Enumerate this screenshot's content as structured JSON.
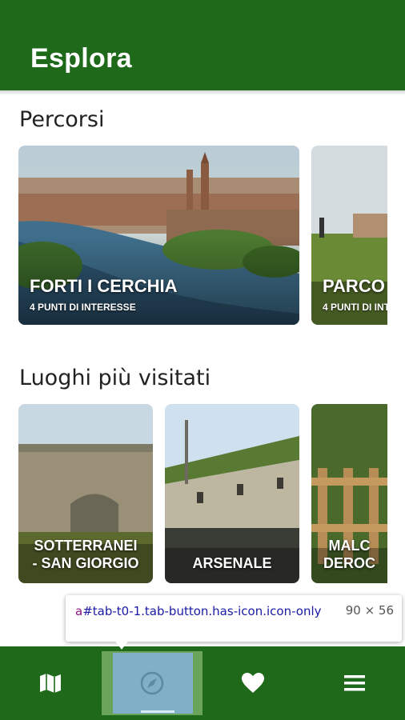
{
  "header": {
    "title": "Esplora"
  },
  "sections": {
    "routes_title": "Percorsi",
    "places_title": "Luoghi più visitati"
  },
  "routes": [
    {
      "title": "FORTI I CERCHIA",
      "subtitle": "4 PUNTI DI INTERESSE"
    },
    {
      "title": "PARCO",
      "subtitle": "4 PUNTI DI INTE"
    }
  ],
  "places": [
    {
      "line1": "SOTTERRANEI",
      "line2": "- SAN GIORGIO"
    },
    {
      "line1": "ARSENALE",
      "line2": ""
    },
    {
      "line1": "MALC",
      "line2": "DEROC"
    }
  ],
  "tabs": [
    {
      "icon": "map-icon"
    },
    {
      "icon": "compass-icon"
    },
    {
      "icon": "heart-icon"
    },
    {
      "icon": "menu-icon"
    }
  ],
  "inspector_tooltip": {
    "tag": "a",
    "selector": "#tab-t0-1.tab-button.has-icon.icon-only",
    "size": "90 × 56"
  },
  "colors": {
    "primary": "#1e6a1a",
    "tab_highlight": "#7fb0c7"
  }
}
